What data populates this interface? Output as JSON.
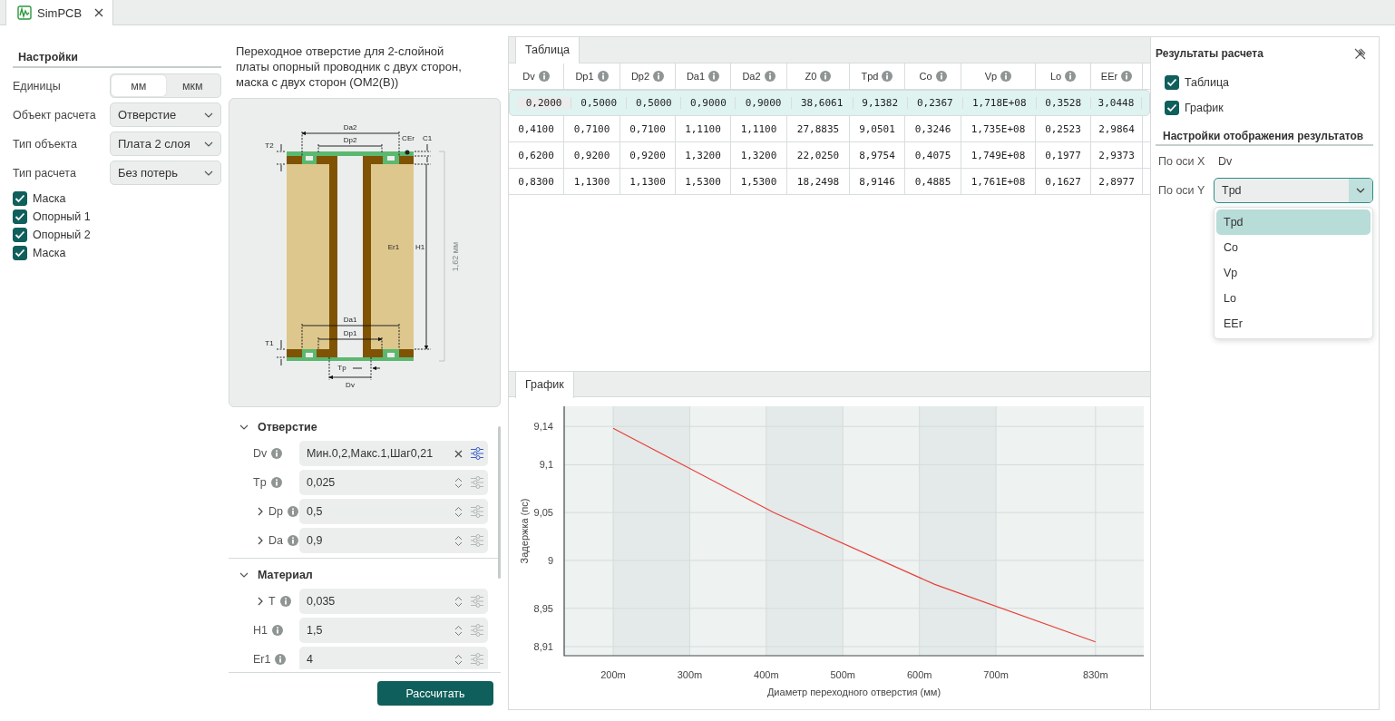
{
  "tab": {
    "title": "SimPCB",
    "selected": true
  },
  "settings": {
    "title": "Настройки",
    "units": {
      "label": "Единицы",
      "options": [
        {
          "label": "мм",
          "selected": true
        },
        {
          "label": "мкм",
          "selected": false
        }
      ]
    },
    "selects": [
      {
        "label": "Объект расчета",
        "value": "Отверстие"
      },
      {
        "label": "Тип объекта",
        "value": "Плата 2 слоя"
      },
      {
        "label": "Тип расчета",
        "value": "Без потерь"
      }
    ],
    "checks": [
      {
        "label": "Маска",
        "checked": true
      },
      {
        "label": "Опорный 1",
        "checked": true
      },
      {
        "label": "Опорный 2",
        "checked": true
      },
      {
        "label": "Маска",
        "checked": true
      }
    ]
  },
  "description": "Переходное отверстие для 2-слойной платы опорный проводник с двух сторон, маска с двух сторон (ОМ2(В))",
  "diagram": {
    "labels": [
      "Da2",
      "Dp2",
      "T2",
      "CEr",
      "C1",
      "Er1",
      "H1",
      "1,62 мм",
      "Da1",
      "Dp1",
      "T1",
      "Tp",
      "Dv"
    ]
  },
  "parameters": [
    {
      "title": "Отверстие",
      "expanded": true,
      "rows": [
        {
          "name": "Dv",
          "value": "Мин.0,2,Макс.1,Шаг0,21",
          "kind": "sweep",
          "expandable": false
        },
        {
          "name": "Tp",
          "value": "0,025",
          "kind": "number",
          "expandable": false
        },
        {
          "name": "Dp",
          "value": "0,5",
          "kind": "number",
          "expandable": true
        },
        {
          "name": "Da",
          "value": "0,9",
          "kind": "number",
          "expandable": true
        }
      ]
    },
    {
      "title": "Материал",
      "expanded": true,
      "rows": [
        {
          "name": "T",
          "value": "0,035",
          "kind": "number",
          "expandable": true
        },
        {
          "name": "H1",
          "value": "1,5",
          "kind": "number",
          "expandable": false
        },
        {
          "name": "Er1",
          "value": "4",
          "kind": "number",
          "expandable": false
        }
      ]
    }
  ],
  "calculate_button": "Рассчитать",
  "results_table": {
    "tab": "Таблица",
    "columns": [
      "Dv",
      "Dp1",
      "Dp2",
      "Da1",
      "Da2",
      "Z0",
      "Tpd",
      "Co",
      "Vp",
      "Lo",
      "EEr"
    ],
    "rows": [
      {
        "selected": true,
        "cells": [
          "0,2000",
          "0,5000",
          "0,5000",
          "0,9000",
          "0,9000",
          "38,6061",
          "9,1382",
          "0,2367",
          "1,718E+08",
          "0,3528",
          "3,0448"
        ]
      },
      {
        "selected": false,
        "cells": [
          "0,4100",
          "0,7100",
          "0,7100",
          "1,1100",
          "1,1100",
          "27,8835",
          "9,0501",
          "0,3246",
          "1,735E+08",
          "0,2523",
          "2,9864"
        ]
      },
      {
        "selected": false,
        "cells": [
          "0,6200",
          "0,9200",
          "0,9200",
          "1,3200",
          "1,3200",
          "22,0250",
          "8,9754",
          "0,4075",
          "1,749E+08",
          "0,1977",
          "2,9373"
        ]
      },
      {
        "selected": false,
        "cells": [
          "0,8300",
          "1,1300",
          "1,1300",
          "1,5300",
          "1,5300",
          "18,2498",
          "8,9146",
          "0,4885",
          "1,761E+08",
          "0,1627",
          "2,8977"
        ]
      }
    ]
  },
  "chart_panel": {
    "tab": "График",
    "chart_data": {
      "type": "line",
      "xlabel": "Диаметр переходного отверстия (мм)",
      "ylabel": "Задержка (пс)",
      "x": [
        200,
        410,
        620,
        830
      ],
      "series": [
        {
          "color": "#e8403a",
          "values": [
            9.138,
            9.05,
            8.975,
            8.915
          ]
        }
      ],
      "grid": true,
      "xlim": [
        136,
        893
      ],
      "ylim": [
        8.9005,
        9.161
      ],
      "xticks": [
        {
          "value": 200,
          "label": "200m"
        },
        {
          "value": 300,
          "label": "300m"
        },
        {
          "value": 400,
          "label": "400m"
        },
        {
          "value": 500,
          "label": "500m"
        },
        {
          "value": 600,
          "label": "600m"
        },
        {
          "value": 700,
          "label": "700m"
        },
        {
          "value": 830,
          "label": "830m"
        }
      ],
      "yticks": [
        {
          "value": 8.91,
          "label": "8,91"
        },
        {
          "value": 8.95,
          "label": "8,95"
        },
        {
          "value": 9,
          "label": "9"
        },
        {
          "value": 9.05,
          "label": "9,05"
        },
        {
          "value": 9.1,
          "label": "9,1"
        },
        {
          "value": 9.14,
          "label": "9,14"
        }
      ]
    }
  },
  "results_panel": {
    "title": "Результаты расчета",
    "checks": [
      {
        "label": "Таблица",
        "checked": true
      },
      {
        "label": "График",
        "checked": true
      }
    ],
    "display_title": "Настройки отображения результатов",
    "x_axis": {
      "label": "По оси X",
      "value": "Dv"
    },
    "y_axis": {
      "label": "По оси Y",
      "value": "Tpd",
      "expanded": true,
      "options": [
        {
          "label": "Tpd",
          "selected": true
        },
        {
          "label": "Co",
          "selected": false
        },
        {
          "label": "Vp",
          "selected": false
        },
        {
          "label": "Lo",
          "selected": false
        },
        {
          "label": "EEr",
          "selected": false
        }
      ]
    }
  }
}
